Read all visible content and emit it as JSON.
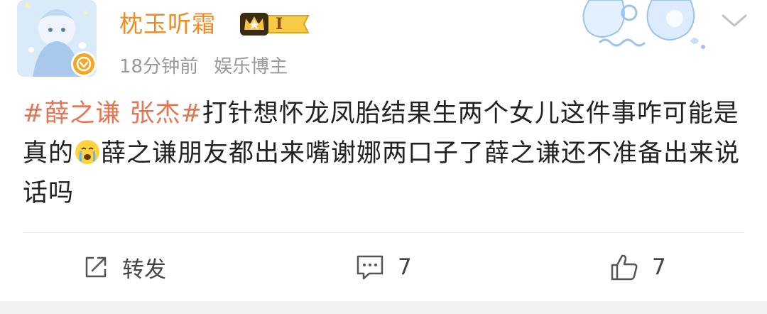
{
  "user": {
    "name": "枕玉听霜",
    "vip_level": "I",
    "time": "18分钟前",
    "source": "娱乐博主"
  },
  "post": {
    "hashtag": "#薛之谦 张杰#",
    "text_part1": "打针想怀龙凤胎结果生两个女儿这件事咋可能是真的",
    "emoji": "crying-face-emoji",
    "text_part2": "薛之谦朋友都出来嘴谢娜两口子了薛之谦还不准备出来说话吗"
  },
  "actions": {
    "repost_label": "转发",
    "comment_count": "7",
    "like_count": "7"
  },
  "colors": {
    "username": "#f08b1f",
    "hashtag": "#eb7350",
    "meta": "#999999",
    "verified": "#f6a623"
  }
}
